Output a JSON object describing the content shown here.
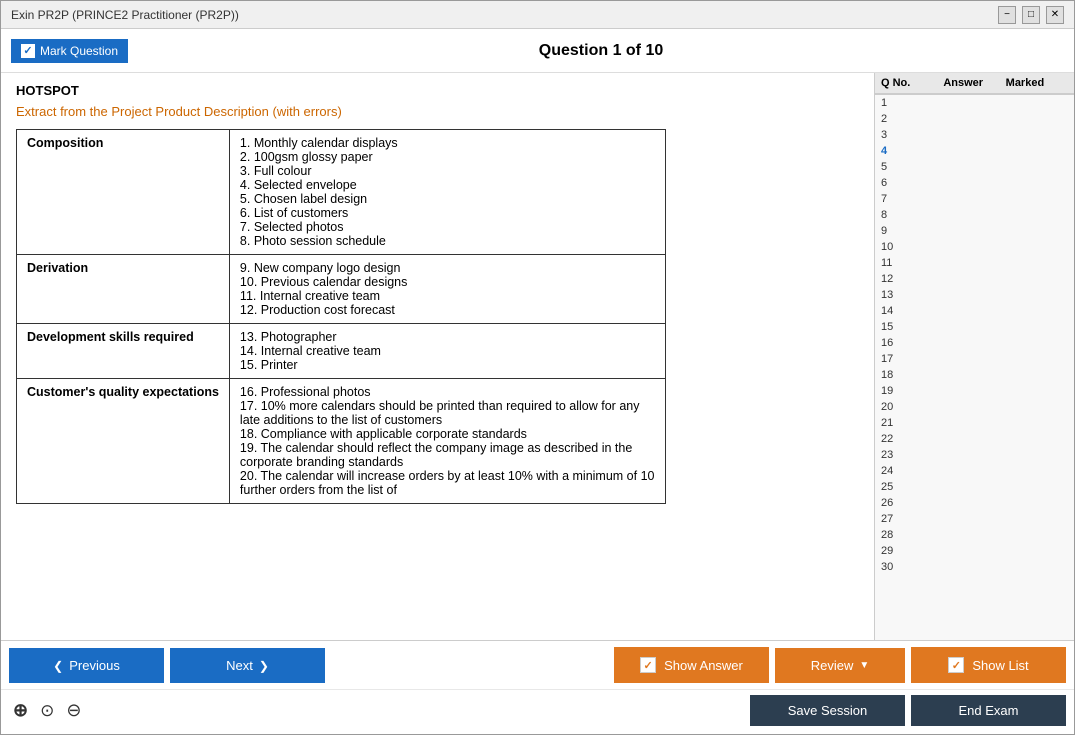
{
  "window": {
    "title": "Exin PR2P (PRINCE2 Practitioner (PR2P))"
  },
  "toolbar": {
    "mark_question_label": "Mark Question",
    "question_title": "Question 1 of 10"
  },
  "content": {
    "hotspot_label": "HOTSPOT",
    "extract_label": "Extract from the Project Product Description (with errors)",
    "table_rows": [
      {
        "heading": "Composition",
        "items": "1. Monthly calendar displays\n2. 100gsm glossy paper\n3. Full colour\n4. Selected envelope\n5. Chosen label design\n6. List of customers\n7. Selected photos\n8. Photo session schedule"
      },
      {
        "heading": "Derivation",
        "items": "9. New company logo design\n10. Previous calendar designs\n11. Internal creative team\n12. Production cost forecast"
      },
      {
        "heading": "Development skills required",
        "items": "13. Photographer\n14. Internal creative team\n15. Printer"
      },
      {
        "heading": "Customer's quality expectations",
        "items": "16. Professional photos\n17. 10% more calendars should be printed than required to allow for any late additions to the list of customers\n18. Compliance with applicable corporate standards\n19. The calendar should reflect the company image as described in the corporate branding standards\n20. The calendar will increase orders by at least 10% with a minimum of 10 further orders from the list of"
      }
    ]
  },
  "sidebar": {
    "col_qno": "Q No.",
    "col_answer": "Answer",
    "col_marked": "Marked",
    "questions": [
      {
        "num": 1
      },
      {
        "num": 2
      },
      {
        "num": 3
      },
      {
        "num": 4,
        "highlighted": true
      },
      {
        "num": 5
      },
      {
        "num": 6
      },
      {
        "num": 7
      },
      {
        "num": 8
      },
      {
        "num": 9
      },
      {
        "num": 10
      },
      {
        "num": 11
      },
      {
        "num": 12
      },
      {
        "num": 13
      },
      {
        "num": 14
      },
      {
        "num": 15
      },
      {
        "num": 16
      },
      {
        "num": 17
      },
      {
        "num": 18
      },
      {
        "num": 19
      },
      {
        "num": 20
      },
      {
        "num": 21
      },
      {
        "num": 22
      },
      {
        "num": 23
      },
      {
        "num": 24
      },
      {
        "num": 25
      },
      {
        "num": 26
      },
      {
        "num": 27
      },
      {
        "num": 28
      },
      {
        "num": 29
      },
      {
        "num": 30
      }
    ]
  },
  "bottom_bar": {
    "previous_label": "Previous",
    "next_label": "Next",
    "show_answer_label": "Show Answer",
    "review_label": "Review",
    "show_list_label": "Show List",
    "save_session_label": "Save Session",
    "end_exam_label": "End Exam"
  },
  "zoom": {
    "zoom_in": "+",
    "zoom_normal": "○",
    "zoom_out": "−"
  },
  "title_controls": {
    "minimize": "−",
    "maximize": "□",
    "close": "✕"
  }
}
